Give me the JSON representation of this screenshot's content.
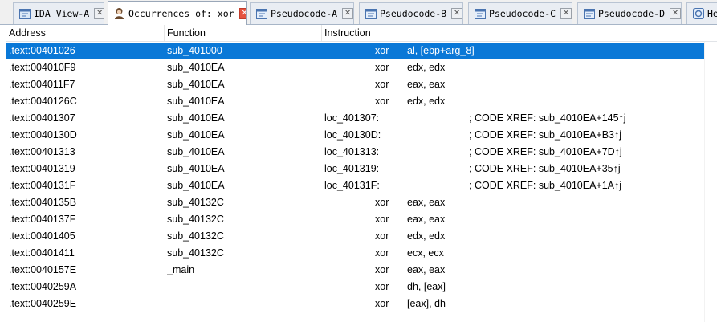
{
  "tabs": [
    {
      "label": "IDA View-A",
      "icon": "ida-view-icon",
      "active": false
    },
    {
      "label": "Occurrences of: xor",
      "icon": "occurrences-icon",
      "active": true
    },
    {
      "label": "Pseudocode-A",
      "icon": "pseudocode-icon",
      "active": false
    },
    {
      "label": "Pseudocode-B",
      "icon": "pseudocode-icon",
      "active": false
    },
    {
      "label": "Pseudocode-C",
      "icon": "pseudocode-icon",
      "active": false
    },
    {
      "label": "Pseudocode-D",
      "icon": "pseudocode-icon",
      "active": false
    },
    {
      "label": "He",
      "icon": "hex-view-icon",
      "active": false
    }
  ],
  "close_glyph": "✕",
  "columns": {
    "address": "Address",
    "function": "Function",
    "instruction": "Instruction"
  },
  "rows": [
    {
      "address": ".text:00401026",
      "function": "sub_401000",
      "mnemonic": "xor",
      "operands": "al, [ebp+arg_8]",
      "selected": true
    },
    {
      "address": ".text:004010F9",
      "function": "sub_4010EA",
      "mnemonic": "xor",
      "operands": "edx, edx"
    },
    {
      "address": ".text:004011F7",
      "function": "sub_4010EA",
      "mnemonic": "xor",
      "operands": "eax, eax"
    },
    {
      "address": ".text:0040126C",
      "function": "sub_4010EA",
      "mnemonic": "xor",
      "operands": "edx, edx"
    },
    {
      "address": ".text:00401307",
      "function": "sub_4010EA",
      "location": "loc_401307:",
      "comment": "; CODE XREF: sub_4010EA+145↑j"
    },
    {
      "address": ".text:0040130D",
      "function": "sub_4010EA",
      "location": "loc_40130D:",
      "comment": " ; CODE XREF: sub_4010EA+B3↑j"
    },
    {
      "address": ".text:00401313",
      "function": "sub_4010EA",
      "location": "loc_401313:",
      "comment": "; CODE XREF: sub_4010EA+7D↑j"
    },
    {
      "address": ".text:00401319",
      "function": "sub_4010EA",
      "location": "loc_401319:",
      "comment": "; CODE XREF: sub_4010EA+35↑j"
    },
    {
      "address": ".text:0040131F",
      "function": "sub_4010EA",
      "location": "loc_40131F:",
      "comment": "; CODE XREF: sub_4010EA+1A↑j"
    },
    {
      "address": ".text:0040135B",
      "function": "sub_40132C",
      "mnemonic": "xor",
      "operands": "eax, eax"
    },
    {
      "address": ".text:0040137F",
      "function": "sub_40132C",
      "mnemonic": "xor",
      "operands": "eax, eax"
    },
    {
      "address": ".text:00401405",
      "function": "sub_40132C",
      "mnemonic": "xor",
      "operands": "edx, edx"
    },
    {
      "address": ".text:00401411",
      "function": "sub_40132C",
      "mnemonic": "xor",
      "operands": "ecx, ecx"
    },
    {
      "address": ".text:0040157E",
      "function": "_main",
      "mnemonic": "xor",
      "operands": "eax, eax"
    },
    {
      "address": ".text:0040259A",
      "function": "",
      "mnemonic": "xor",
      "operands": "dh, [eax]"
    },
    {
      "address": ".text:0040259E",
      "function": "",
      "mnemonic": "xor",
      "operands": "[eax], dh"
    }
  ],
  "colors": {
    "selection": "#0a78d7",
    "close_active": "#e6533f"
  }
}
